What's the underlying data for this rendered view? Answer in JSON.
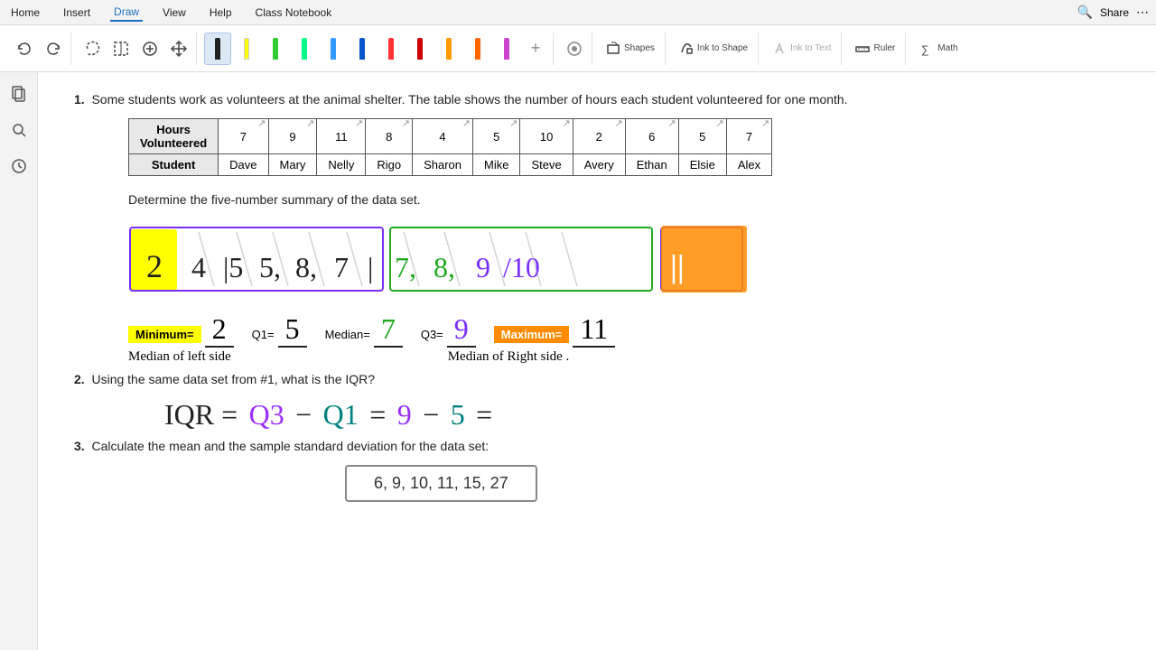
{
  "menuBar": {
    "items": [
      "Home",
      "Insert",
      "Draw",
      "View",
      "Help",
      "Class Notebook"
    ]
  },
  "toolbar": {
    "inkToShape": "Ink to Shape",
    "inkToText": "Ink to Text",
    "shapes": "Shapes",
    "ruler": "Ruler",
    "math": "Math"
  },
  "sidebar": {
    "icons": [
      "pages",
      "search",
      "history"
    ]
  },
  "problem1": {
    "text": "Some students work as volunteers at the animal shelter. The table shows the number of hours each student volunteered for one month.",
    "tableHeaders": [
      "Hours Volunteered",
      "7",
      "9",
      "11",
      "8",
      "4",
      "5",
      "10",
      "2",
      "6",
      "5",
      "7"
    ],
    "tableRow2": [
      "Student",
      "Dave",
      "Mary",
      "Nelly",
      "Rigo",
      "Sharon",
      "Mike",
      "Steve",
      "Avery",
      "Ethan",
      "Elsie",
      "Alex"
    ],
    "fiveNumberTitle": "Determine the five-number summary of the data set.",
    "sortedNumbers": "2  4 5,5, 8, 7  7,8,9,10",
    "minimum": {
      "label": "Minimum=",
      "value": "2"
    },
    "q1": {
      "label": "Q1=",
      "value": "5"
    },
    "median": {
      "label": "Median=",
      "value": "7"
    },
    "q3": {
      "label": "Q3=",
      "value": "9"
    },
    "maximum": {
      "label": "Maximum=",
      "value": "11"
    },
    "medianLeftNote": "Median of left side",
    "medianRightNote": "Median of Right side ."
  },
  "problem2": {
    "text": "Using the same data set from #1, what is the IQR?",
    "formula": "IQR = Q3 - Q1 = 9 - 5 ="
  },
  "problem3": {
    "text": "Calculate the mean and the sample standard deviation for the data set:",
    "dataSet": "6, 9, 10, 11, 15, 27"
  },
  "colors": {
    "yellow": "#ffff00",
    "orange": "#ff8c00",
    "purple": "#7b2fff",
    "green": "#22aa22",
    "teal": "#008080",
    "penColors": [
      "#000000",
      "#ffff00",
      "#00cc00",
      "#00cc00",
      "#33aaff",
      "#33aaff",
      "#ff3333",
      "#ff3333",
      "#ff9900",
      "#ff9900",
      "#cc44cc"
    ]
  }
}
